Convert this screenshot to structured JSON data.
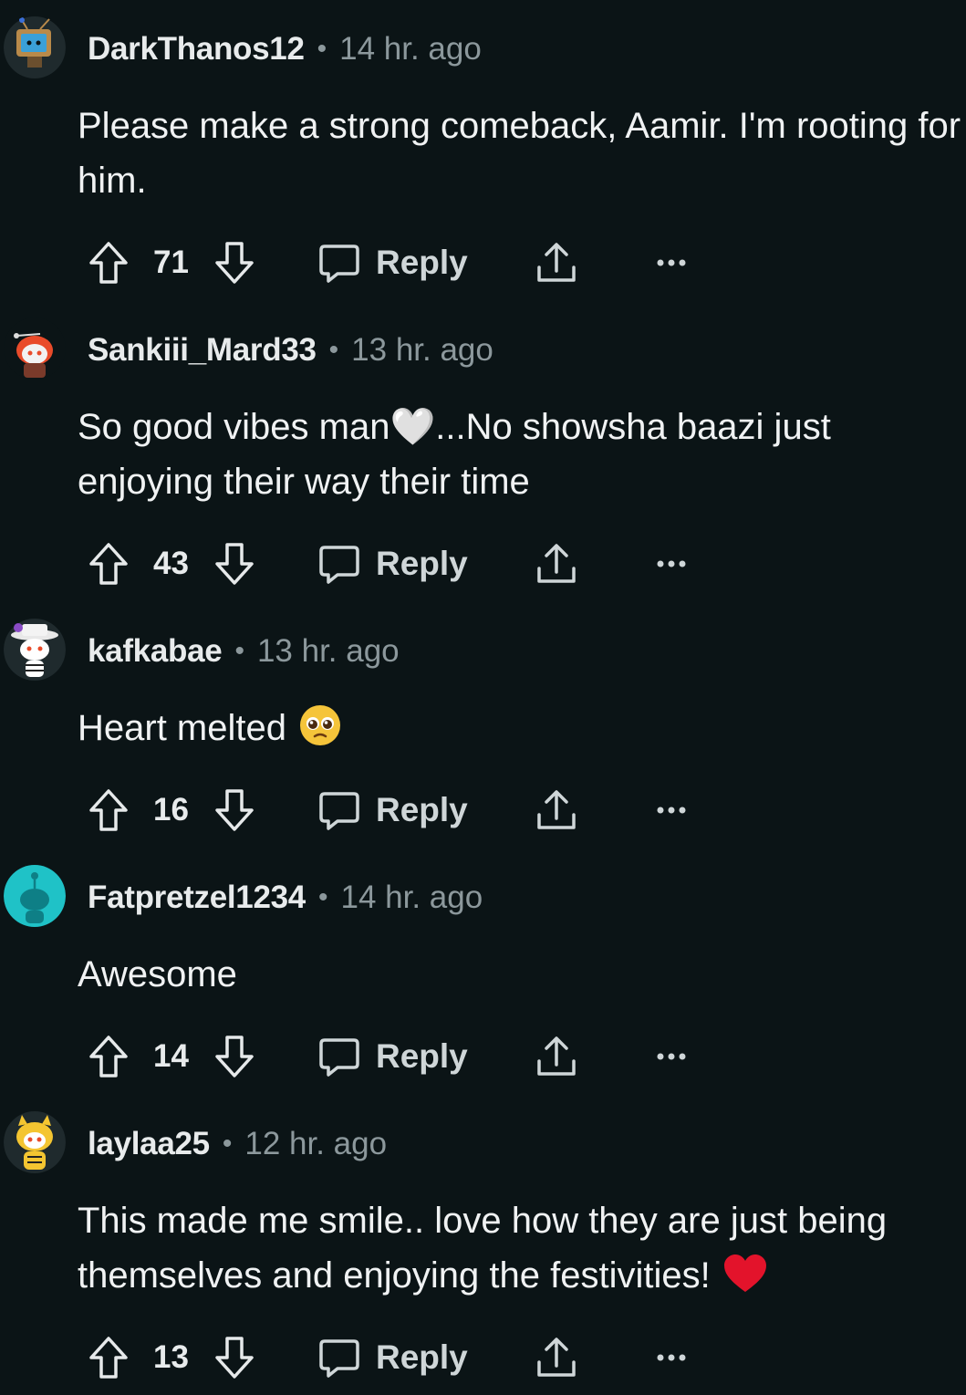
{
  "comments": [
    {
      "username": "DarkThanos12",
      "separator": "•",
      "time": "14 hr. ago",
      "body": "Please make a strong comeback, Aamir. I'm rooting for him.",
      "emoji": "",
      "score": "71",
      "reply_label": "Reply",
      "avatar": "tv-snoo-avatar"
    },
    {
      "username": "Sankiii_Mard33",
      "separator": "•",
      "time": "13 hr. ago",
      "body": "So good vibes man🤍...No showsha baazi just enjoying their way their time",
      "emoji": "",
      "score": "43",
      "reply_label": "Reply",
      "avatar": "red-hair-snoo-avatar"
    },
    {
      "username": "kafkabae",
      "separator": "•",
      "time": "13 hr. ago",
      "body": "Heart melted ",
      "emoji": "pleading-face",
      "score": "16",
      "reply_label": "Reply",
      "avatar": "hat-snoo-avatar"
    },
    {
      "username": "Fatpretzel1234",
      "separator": "•",
      "time": "14 hr. ago",
      "body": "Awesome",
      "emoji": "",
      "score": "14",
      "reply_label": "Reply",
      "avatar": "default-snoo-avatar"
    },
    {
      "username": "laylaa25",
      "separator": "•",
      "time": "12 hr. ago",
      "body": "This made me smile.. love how they are just being themselves and enjoying the festivities! ",
      "emoji": "red-heart",
      "score": "13",
      "reply_label": "Reply",
      "avatar": "tiger-snoo-avatar"
    }
  ],
  "colors": {
    "background": "#0b1416",
    "text": "#f0f2f3",
    "muted": "#8c989c",
    "default_avatar": "#1fc2c7"
  },
  "icons": [
    "upvote-icon",
    "downvote-icon",
    "reply-icon",
    "share-icon",
    "more-icon"
  ]
}
